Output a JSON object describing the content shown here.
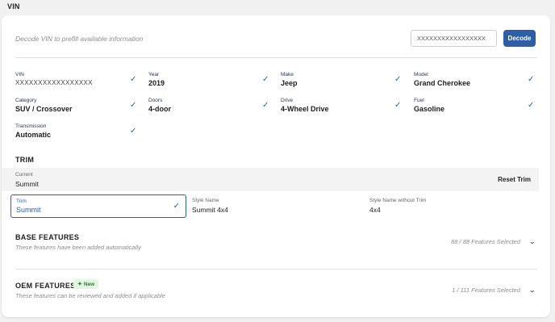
{
  "section": {
    "title": "VIN"
  },
  "decode": {
    "hint": "Decode VIN to prefill available information",
    "input_value": "XXXXXXXXXXXXXXXXX",
    "button_label": "Decode"
  },
  "fields": [
    {
      "label": "VIN",
      "value": "XXXXXXXXXXXXXXXXX"
    },
    {
      "label": "Year",
      "value": "2019"
    },
    {
      "label": "Make",
      "value": "Jeep"
    },
    {
      "label": "Model",
      "value": "Grand Cherokee"
    },
    {
      "label": "Category",
      "value": "SUV / Crossover"
    },
    {
      "label": "Doors",
      "value": "4-door"
    },
    {
      "label": "Drive",
      "value": "4-Wheel Drive"
    },
    {
      "label": "Fuel",
      "value": "Gasoline"
    },
    {
      "label": "Transmission",
      "value": "Automatic"
    }
  ],
  "trim": {
    "heading": "TRIM",
    "current_label": "Current",
    "current_value": "Summit",
    "reset_label": "Reset Trim",
    "trim_label": "Trim",
    "trim_value": "Summit",
    "style_name_label": "Style Name",
    "style_name_value": "Summit 4x4",
    "style_no_trim_label": "Style Name without Trim",
    "style_no_trim_value": "4x4"
  },
  "base_features": {
    "title": "BASE FEATURES",
    "subtitle": "These features have been added automatically",
    "count": "88 / 88 Features Selected"
  },
  "oem_features": {
    "title": "OEM FEATURES",
    "badge": "New",
    "subtitle": "These features can be reviewed and added if applicable",
    "count": "1 / 111 Features Selected"
  },
  "icons": {
    "check": "check-icon",
    "chevron": "chevron-down-icon",
    "sparkle": "sparkle-icon"
  },
  "colors": {
    "accent": "#2d5fa6",
    "badge_bg": "#e3f4e3",
    "badge_fg": "#2e7d32"
  }
}
